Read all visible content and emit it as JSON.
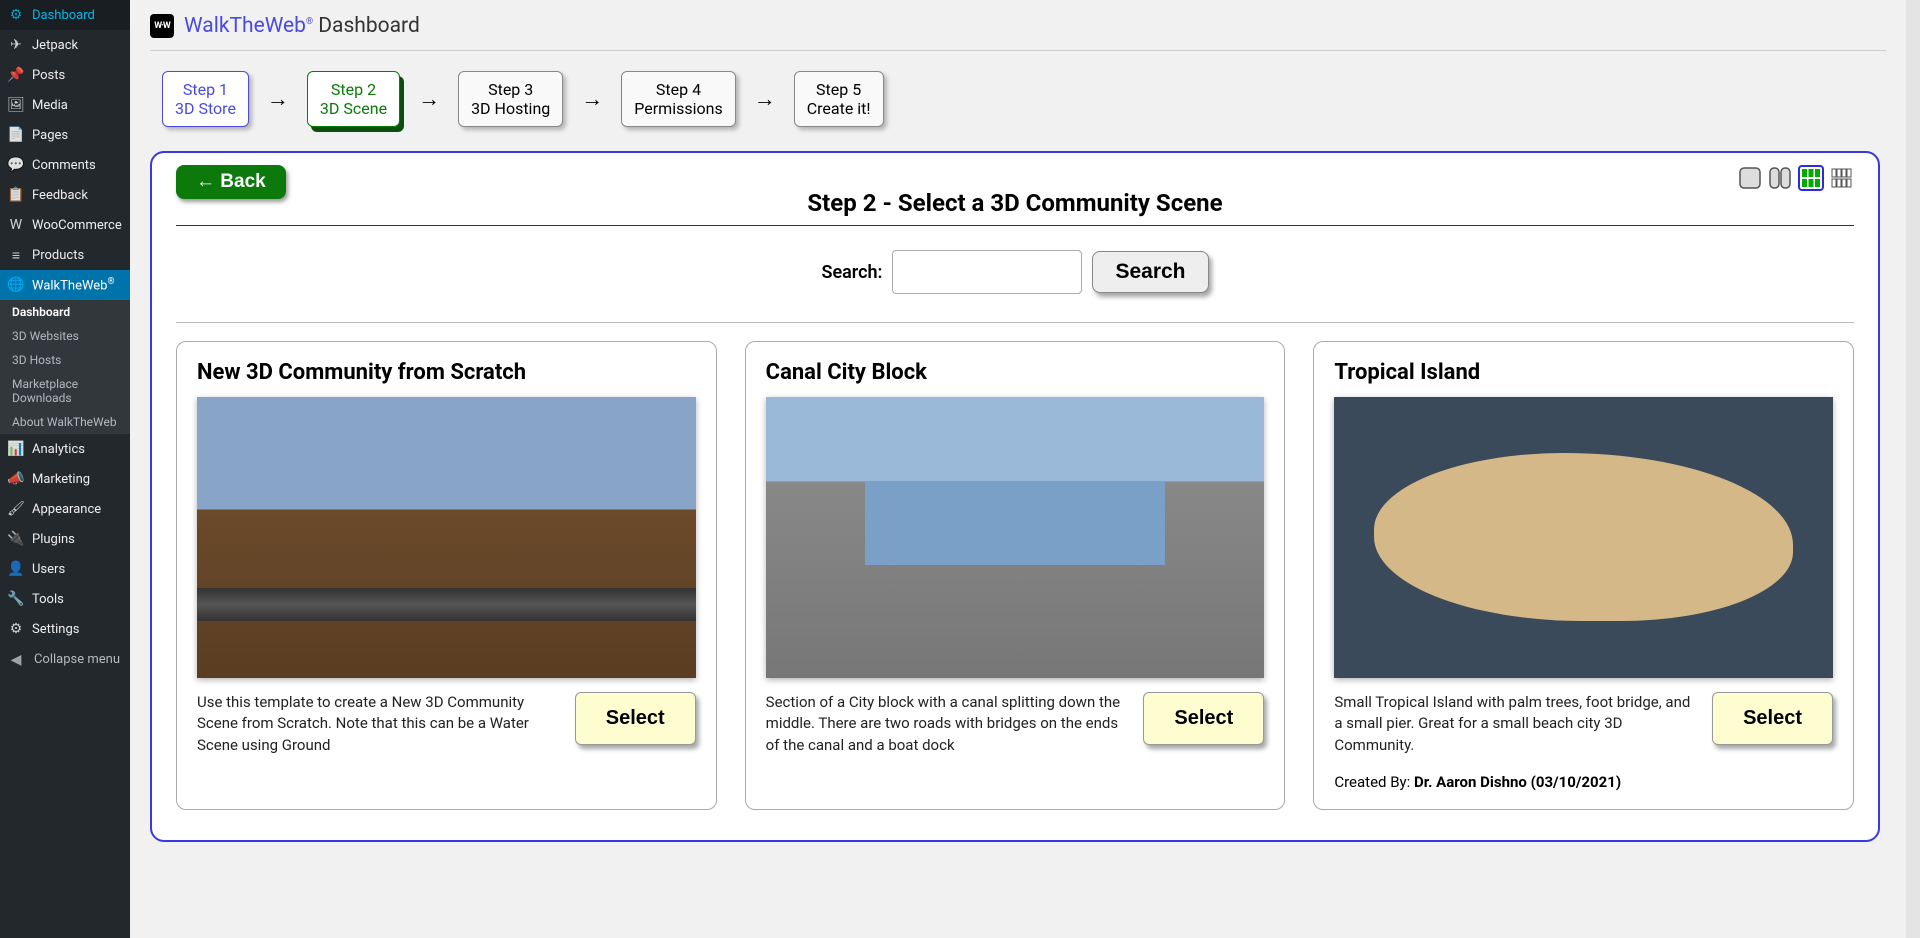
{
  "sidebar": {
    "items": [
      {
        "icon": "⚙",
        "label": "Dashboard"
      },
      {
        "icon": "✈",
        "label": "Jetpack"
      },
      {
        "icon": "📌",
        "label": "Posts"
      },
      {
        "icon": "🖼",
        "label": "Media"
      },
      {
        "icon": "📄",
        "label": "Pages"
      },
      {
        "icon": "💬",
        "label": "Comments"
      },
      {
        "icon": "📋",
        "label": "Feedback"
      },
      {
        "icon": "W",
        "label": "WooCommerce"
      },
      {
        "icon": "≡",
        "label": "Products"
      },
      {
        "icon": "🌐",
        "label": "WalkTheWeb"
      }
    ],
    "subitems": [
      "Dashboard",
      "3D Websites",
      "3D Hosts",
      "Marketplace Downloads",
      "About WalkTheWeb"
    ],
    "items2": [
      {
        "icon": "📊",
        "label": "Analytics"
      },
      {
        "icon": "📣",
        "label": "Marketing"
      },
      {
        "icon": "🖌",
        "label": "Appearance"
      },
      {
        "icon": "🔌",
        "label": "Plugins"
      },
      {
        "icon": "👤",
        "label": "Users"
      },
      {
        "icon": "🔧",
        "label": "Tools"
      },
      {
        "icon": "⚙",
        "label": "Settings"
      }
    ],
    "collapse_icon": "◀",
    "collapse_label": "Collapse menu"
  },
  "header": {
    "brand": "WalkTheWeb",
    "title_suffix": " Dashboard"
  },
  "steps": [
    {
      "n": "Step 1",
      "t": "3D Store"
    },
    {
      "n": "Step 2",
      "t": "3D Scene"
    },
    {
      "n": "Step 3",
      "t": "3D Hosting"
    },
    {
      "n": "Step 4",
      "t": "Permissions"
    },
    {
      "n": "Step 5",
      "t": "Create it!"
    }
  ],
  "panel": {
    "back_label": "← Back",
    "title": "Step 2 - Select a 3D Community Scene",
    "search_label": "Search:",
    "search_value": "",
    "search_button": "Search"
  },
  "cards": [
    {
      "title": "New 3D Community from Scratch",
      "desc": "Use this template to create a New 3D Community Scene from Scratch. Note that this can be a Water Scene using Ground",
      "select": "Select"
    },
    {
      "title": "Canal City Block",
      "desc": "Section of a City block with a canal splitting down the middle. There are two roads with bridges on the ends of the canal and a boat dock",
      "select": "Select"
    },
    {
      "title": "Tropical Island",
      "desc": "Small Tropical Island with palm trees, foot bridge, and a small pier. Great for a small beach city 3D Community.",
      "select": "Select",
      "credit_prefix": "Created By: ",
      "credit_author": "Dr. Aaron Dishno ",
      "credit_date": "(03/10/2021)"
    }
  ]
}
